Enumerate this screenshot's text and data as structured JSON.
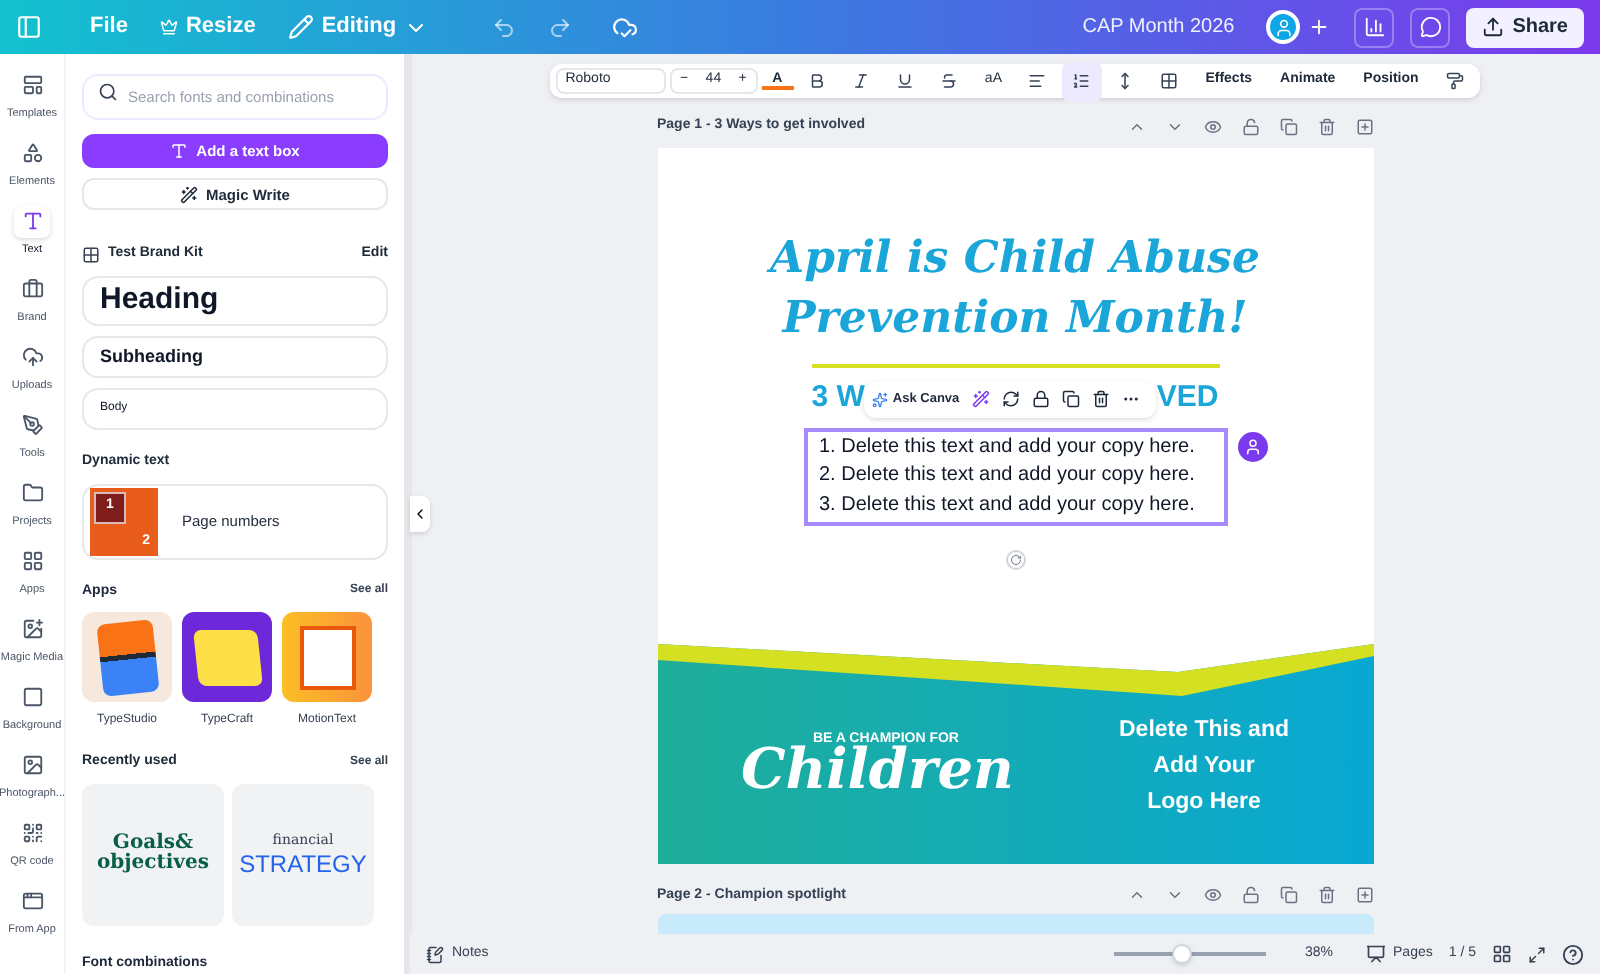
{
  "topbar": {
    "menu": [
      {
        "label": "File",
        "kind": "plain"
      },
      {
        "label": "Resize",
        "kind": "crown"
      },
      {
        "label": "Editing",
        "kind": "dropdown"
      }
    ],
    "title": "CAP Month 2026",
    "share": "Share"
  },
  "rail": [
    {
      "label": "Templates",
      "kind": "templates",
      "selected": false
    },
    {
      "label": "Elements",
      "kind": "elements",
      "selected": false
    },
    {
      "label": "Text",
      "kind": "text",
      "selected": true
    },
    {
      "label": "Brand",
      "kind": "brand",
      "selected": false
    },
    {
      "label": "Uploads",
      "kind": "uploads",
      "selected": false
    },
    {
      "label": "Tools",
      "kind": "tools",
      "selected": false
    },
    {
      "label": "Projects",
      "kind": "projects",
      "selected": false
    },
    {
      "label": "Apps",
      "kind": "apps",
      "selected": false
    },
    {
      "label": "Magic Media",
      "kind": "magic",
      "selected": false
    },
    {
      "label": "Background",
      "kind": "background",
      "selected": false
    },
    {
      "label": "Photograph...",
      "kind": "photo",
      "selected": false
    },
    {
      "label": "QR code",
      "kind": "qr",
      "selected": false
    },
    {
      "label": "From App",
      "kind": "fromapp",
      "selected": false
    }
  ],
  "panel": {
    "search": {
      "placeholder": "Search fonts and combinations"
    },
    "add_text_box": "Add a text box",
    "magic_write": "Magic Write",
    "brand_kit": {
      "title": "Test Brand Kit",
      "edit": "Edit",
      "styles": [
        {
          "label": "Heading",
          "kind": "heading"
        },
        {
          "label": "Subheading",
          "kind": "subheading"
        },
        {
          "label": "Body",
          "kind": "body"
        }
      ]
    },
    "dynamic_text": {
      "title": "Dynamic text",
      "item": "Page numbers",
      "thumb_digits": [
        "1",
        "2"
      ]
    },
    "apps": {
      "title": "Apps",
      "see_all": "See all",
      "items": [
        {
          "label": "TypeStudio",
          "kind": "typestudio"
        },
        {
          "label": "TypeCraft",
          "kind": "typecraft"
        },
        {
          "label": "MotionText",
          "kind": "motiontext"
        }
      ]
    },
    "recently_used": {
      "title": "Recently used",
      "see_all": "See all",
      "items": [
        {
          "kind": "goals",
          "lines": [
            "Goals&",
            "objectives"
          ]
        },
        {
          "kind": "strategy",
          "lines": [
            "financial",
            "STRATEGY"
          ]
        }
      ]
    },
    "font_combinations": "Font combinations"
  },
  "toolbar": {
    "color_letter": "A",
    "font": "Roboto",
    "minus": "−",
    "size": "44",
    "plus": "+",
    "case": "aA",
    "buttons": [
      "Effects",
      "Animate",
      "Position"
    ]
  },
  "pages": [
    {
      "title": "Page 1 - 3 Ways to get involved"
    },
    {
      "title": "Page 2 - Champion spotlight"
    }
  ],
  "design": {
    "title_lines": [
      "April is Child Abuse",
      "Prevention Month!"
    ],
    "subtitle_left": "3 W",
    "subtitle_right": "VED",
    "ask_canva": "Ask Canva",
    "list": [
      {
        "number": "1.",
        "text": "Delete this text and add your copy here."
      },
      {
        "number": "2.",
        "text": "Delete this text and add your copy here."
      },
      {
        "number": "3.",
        "text": "Delete this text and add your copy here."
      }
    ],
    "champion": "BE A CHAMPION FOR",
    "children": "Children",
    "logo_lines": [
      "Delete This and",
      "Add Your",
      "Logo Here"
    ]
  },
  "bottombar": {
    "notes": "Notes",
    "zoom": {
      "level": 0.45
    },
    "zoom_label": "38%",
    "pages": "Pages",
    "page_count": "1 / 5"
  }
}
